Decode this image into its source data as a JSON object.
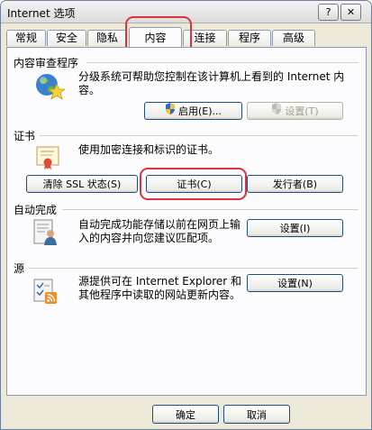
{
  "window": {
    "title": "Internet 选项",
    "help": "?",
    "close": "✕"
  },
  "tabs": [
    "常规",
    "安全",
    "隐私",
    "内容",
    "连接",
    "程序",
    "高级"
  ],
  "content_advisor": {
    "title": "内容审查程序",
    "desc": "分级系统可帮助您控制在该计算机上看到的 Internet 内容。",
    "enable_label": "启用(E)...",
    "settings_label": "设置(T)"
  },
  "certificates": {
    "title": "证书",
    "desc": "使用加密连接和标识的证书。",
    "clear_ssl_label": "清除 SSL 状态(S)",
    "certs_label": "证书(C)",
    "publishers_label": "发行者(B)"
  },
  "autocomplete": {
    "title": "自动完成",
    "desc": "自动完成功能存储以前在网页上输入的内容并向您建议匹配项。",
    "settings_label": "设置(I)"
  },
  "feeds": {
    "title": "源",
    "desc": "源提供可在 Internet Explorer 和其他程序中读取的网站更新内容。",
    "settings_label": "设置(N)"
  },
  "footer": {
    "ok_label": "确定",
    "cancel_label": "取消"
  },
  "icons": {
    "content_advisor": "globe-star-icon",
    "certificates": "certificate-icon",
    "autocomplete": "autocomplete-form-icon",
    "feeds": "feed-icon",
    "uac": "uac-shield-icon"
  },
  "colors": {
    "highlight_ring": "#e0303f",
    "button_border": "#1e4e88"
  }
}
